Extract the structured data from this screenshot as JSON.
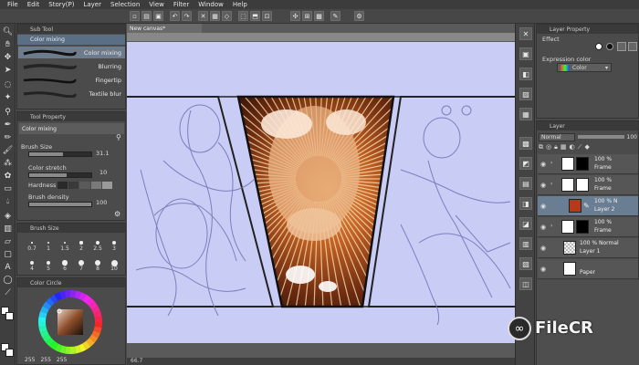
{
  "menu": [
    "File",
    "Edit",
    "Story(P)",
    "Layer",
    "Selection",
    "View",
    "Filter",
    "Window",
    "Help"
  ],
  "document_tab": "New canvas*",
  "sub_tool": {
    "title": "Sub Tool",
    "group": "Color mixing",
    "brushes": [
      "Color mixing",
      "Blurring",
      "Fingertip",
      "Textile blur"
    ]
  },
  "tool_property": {
    "title": "Tool Property",
    "current": "Color mixing",
    "brush_size_label": "Brush Size",
    "brush_size_value": "31.1",
    "brush_size_fraction": 0.55,
    "color_stretch_label": "Color stretch",
    "color_stretch_value": "10",
    "color_stretch_fraction": 0.6,
    "hardness_label": "Hardness",
    "brush_density_label": "Brush density",
    "brush_density_value": "100",
    "brush_density_fraction": 1.0
  },
  "brush_size": {
    "title": "Brush Size",
    "row1": [
      "0.7",
      "1",
      "1.5",
      "2",
      "2.5",
      "3"
    ],
    "row2": [
      "4",
      "5",
      "6",
      "7",
      "8",
      "10"
    ]
  },
  "color_circle": {
    "title": "Color Circle",
    "rgb": [
      "255",
      "255",
      "255"
    ]
  },
  "status": {
    "zoom": "66.7"
  },
  "layer_property": {
    "title": "Layer Property",
    "effect_label": "Effect",
    "expression_color_label": "Expression color",
    "expression_color_value": "Color"
  },
  "layer_panel": {
    "title": "Layer",
    "blend_mode": "Normal",
    "opacity": "100",
    "layers": [
      {
        "pct": "100 %",
        "name": "Frame"
      },
      {
        "pct": "100 %",
        "name": "Frame"
      },
      {
        "pct": "100 %  N",
        "name": "Layer 2"
      },
      {
        "pct": "100 %",
        "name": "Frame"
      },
      {
        "pct": "100 %  Normal",
        "name": "Layer 1"
      },
      {
        "pct": "",
        "name": "Paper"
      }
    ]
  },
  "watermark": {
    "brand": "FileCR"
  },
  "colors": {
    "paper": "#c9ccf4",
    "selection": "#6d7c8c",
    "explosion_core": "#d98a45"
  }
}
